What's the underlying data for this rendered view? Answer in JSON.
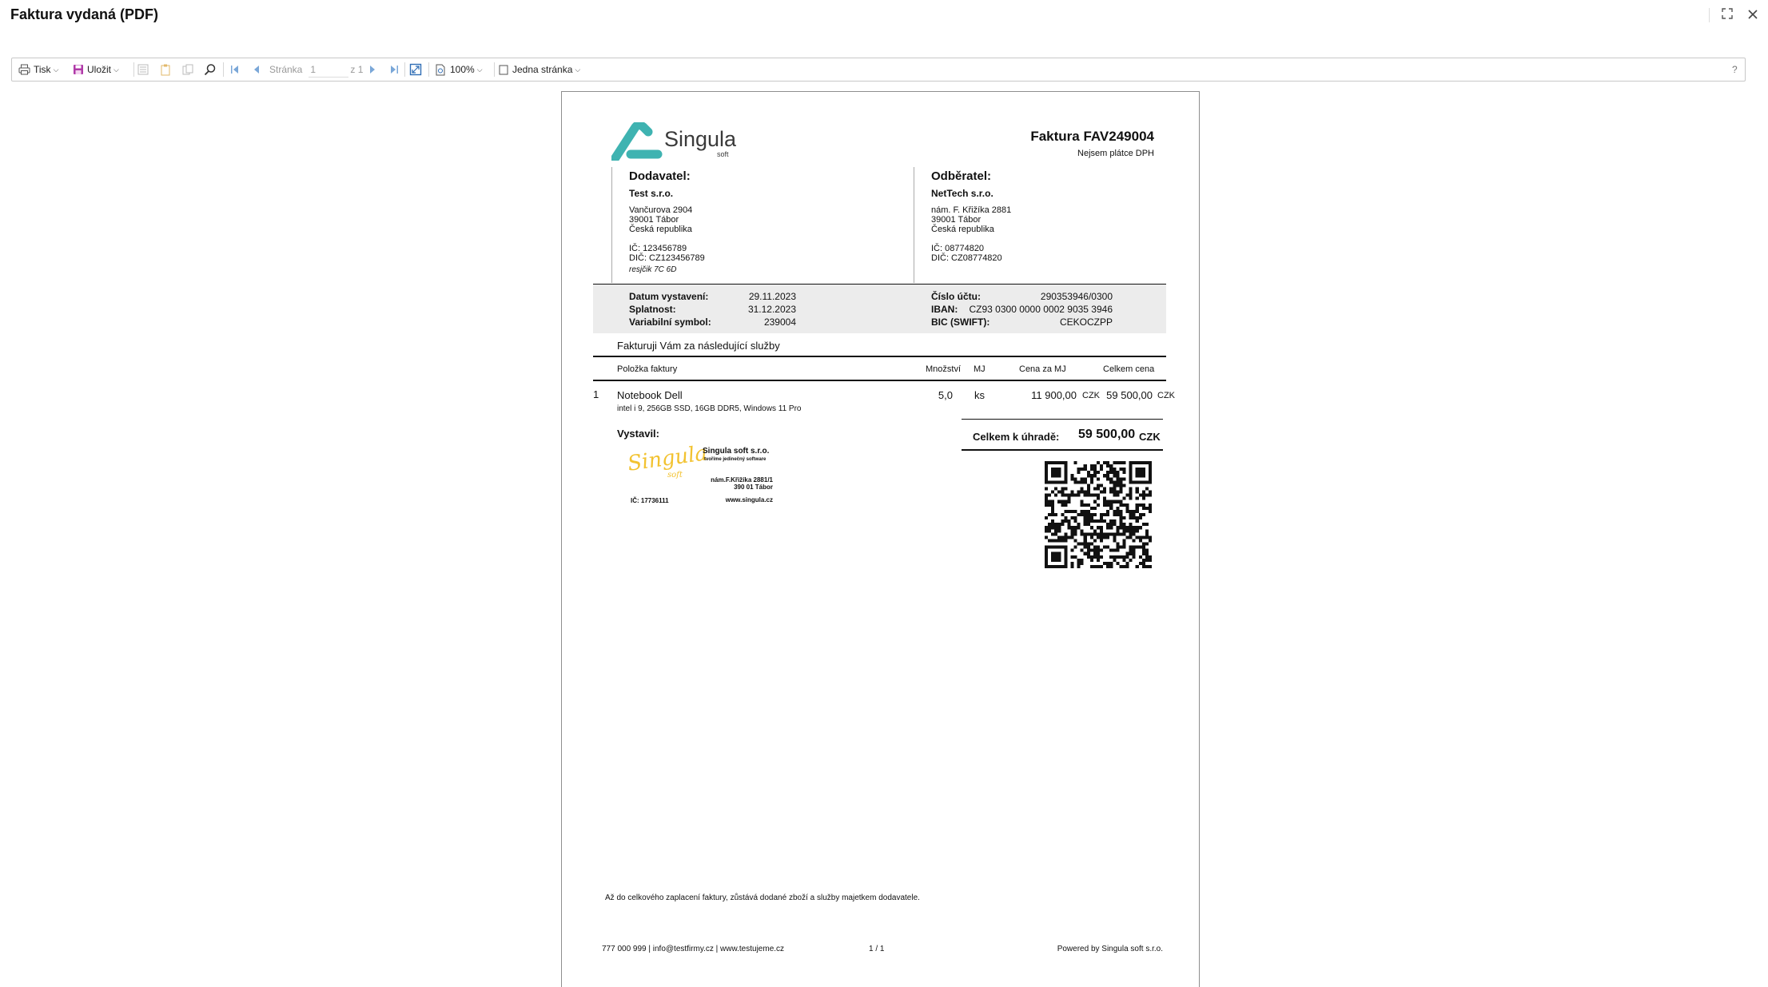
{
  "window": {
    "title": "Faktura vydaná (PDF)"
  },
  "toolbar": {
    "print_label": "Tisk",
    "save_label": "Uložit",
    "page_label": "Stránka",
    "page_value": "1",
    "page_of": "z 1",
    "zoom": "100%",
    "view_mode": "Jedna stránka",
    "help": "?"
  },
  "invoice": {
    "logo_text": "Singula",
    "logo_sub": "soft",
    "title": "Faktura FAV249004",
    "vat_note": "Nejsem plátce DPH",
    "supplier": {
      "heading": "Dodavatel:",
      "name": "Test s.r.o.",
      "street": "Vančurova 2904",
      "city": "39001 Tábor",
      "country": "Česká republika",
      "ic": "IČ: 123456789",
      "dic": "DIČ: CZ123456789",
      "note": "resjčik 7C 6D"
    },
    "customer": {
      "heading": "Odběratel:",
      "name": "NetTech s.r.o.",
      "street": "nám. F. Křižíka 2881",
      "city": "39001 Tábor",
      "country": "Česká republika",
      "ic": "IČ: 08774820",
      "dic": "DIČ: CZ08774820"
    },
    "dates": {
      "issue_label": "Datum vystavení:",
      "issue_value": "29.11.2023",
      "due_label": "Splatnost:",
      "due_value": "31.12.2023",
      "vs_label": "Variabilní symbol:",
      "vs_value": "239004"
    },
    "bank": {
      "account_label": "Číslo účtu:",
      "account_value": "290353946/0300",
      "iban_label": "IBAN:",
      "iban_value": "CZ93 0300 0000 0002 9035 3946",
      "bic_label": "BIC (SWIFT):",
      "bic_value": "CEKOCZPP"
    },
    "intro": "Fakturuji Vám za následující služby",
    "columns": {
      "item": "Položka faktury",
      "qty": "Množství",
      "unit": "MJ",
      "unit_price": "Cena za MJ",
      "total": "Celkem cena"
    },
    "items": [
      {
        "no": "1",
        "name": "Notebook Dell",
        "desc": "intel i 9, 256GB SSD, 16GB DDR5, Windows 11 Pro",
        "qty": "5,0",
        "unit": "ks",
        "unit_price": "11 900,00",
        "unit_price_cur": "CZK",
        "total": "59 500,00",
        "total_cur": "CZK"
      }
    ],
    "issued_by": "Vystavil:",
    "stamp": {
      "signature": "Singula",
      "signature_sub": "soft",
      "company": "Singula soft s.r.o.",
      "tagline": "tvoříme jedinečný software",
      "addr1": "nám.F.Křižíka 2881/1",
      "addr2": "390 01 Tábor",
      "ic": "IČ: 17736111",
      "web": "www.singula.cz"
    },
    "total_label": "Celkem k úhradě:",
    "total_value": "59 500,00",
    "total_cur": "CZK",
    "ownership_note": "Až do celkového zaplacení faktury, zůstává dodané zboží a služby majetkem dodavatele.",
    "footer_contact": "777 000 999 | info@testfirmy.cz | www.testujeme.cz",
    "footer_page": "1 / 1",
    "footer_powered": "Powered by Singula soft s.r.o."
  },
  "colors": {
    "brand_teal": "#3fb3b1",
    "signature_yellow": "#f2c230",
    "shade": "#ececec"
  }
}
